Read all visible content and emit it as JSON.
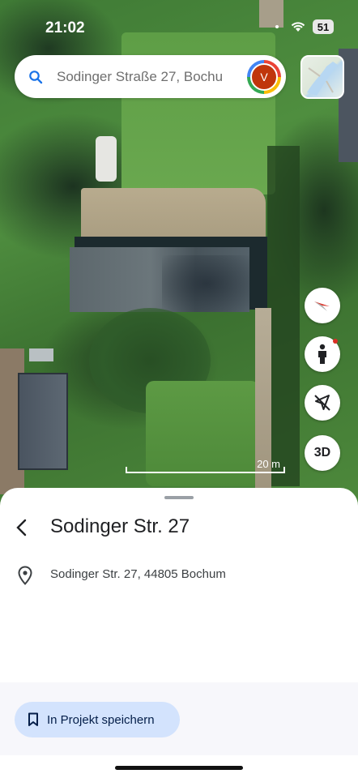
{
  "status_bar": {
    "time": "21:02",
    "battery": "51"
  },
  "search": {
    "placeholder": "Sodinger Straße 27, Bochu",
    "avatar_initial": "V"
  },
  "map": {
    "scale_label": "20 m",
    "buttons": {
      "three_d": "3D"
    },
    "icons": [
      "search-icon",
      "layers-icon",
      "compass-icon",
      "street-view-pegman-icon",
      "location-off-icon"
    ]
  },
  "place": {
    "title": "Sodinger Str. 27",
    "address": "Sodinger Str. 27, 44805 Bochum",
    "save_label": "In Projekt speichern"
  },
  "colors": {
    "accent": "#d3e3fd",
    "avatar": "#c0360c",
    "alert_dot": "#d93025"
  }
}
